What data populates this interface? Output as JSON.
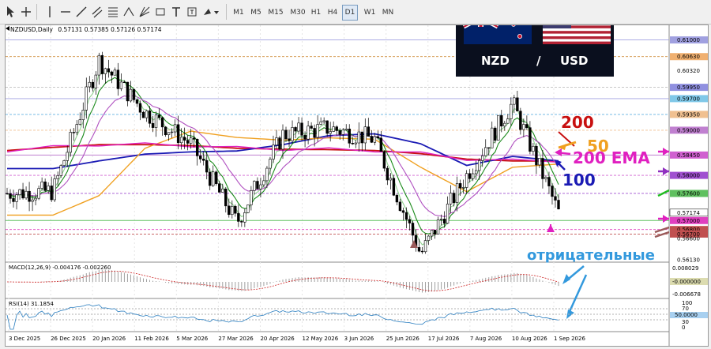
{
  "toolbar": {
    "timeframes": [
      "M1",
      "M5",
      "M15",
      "M30",
      "H1",
      "H4",
      "D1",
      "W1",
      "MN"
    ],
    "active_timeframe": "D1"
  },
  "chart_header": {
    "symbol_text": "NZDUSD,Daily",
    "ohlc_text": "0.57131 0.57385 0.57126 0.57174"
  },
  "flag_panel": {
    "base": "NZD",
    "separator": "/",
    "quote": "USD"
  },
  "annotations": {
    "ema200": "200",
    "ema50": "50",
    "ema_label": "200 EMA",
    "ema100": "100",
    "negative": "отрицательные"
  },
  "price_axis": {
    "labels": [
      "0.61000",
      "0.60630",
      "0.60320",
      "0.59950",
      "0.59700",
      "0.59350",
      "0.59000",
      "0.58450",
      "0.58000",
      "0.57600",
      "0.57174",
      "0.57000",
      "0.56800",
      "0.56700",
      "0.56600",
      "0.56130"
    ]
  },
  "macd": {
    "label": "MACD(12,26,9) -0.004176 -0.002260",
    "axis": [
      "0.008029",
      "-0.000000",
      "-0.006678"
    ]
  },
  "rsi": {
    "label": "RSI(14) 31.1854",
    "axis": [
      "100",
      "70",
      "50.0000",
      "30",
      "0"
    ]
  },
  "time_axis": {
    "labels": [
      "3 Dec 2025",
      "26 Dec 2025",
      "20 Jan 2026",
      "11 Feb 2026",
      "5 Mar 2026",
      "27 Mar 2026",
      "20 Apr 2026",
      "12 May 2026",
      "3 Jun 2026",
      "25 Jun 2026",
      "17 Jul 2026",
      "7 Aug 2026",
      "10 Aug 2026",
      "1 Sep 2026"
    ]
  },
  "colors": {
    "ema200": "#c81010",
    "ema100": "#1a1ab4",
    "ema50": "#f0a020",
    "ema_pink": "#e020c0",
    "fast_ma": "#1a8a1a",
    "slow_ma": "#b050c0",
    "annotation_blue": "#3399dd"
  },
  "chart_data": {
    "type": "line",
    "title": "NZDUSD,Daily",
    "instrument": "NZD/USD",
    "timeframe": "D1",
    "x": [
      "3 Dec 2025",
      "26 Dec 2025",
      "20 Jan 2026",
      "11 Feb 2026",
      "5 Mar 2026",
      "27 Mar 2026",
      "20 Apr 2026",
      "12 May 2026",
      "3 Jun 2026",
      "25 Jun 2026",
      "17 Jul 2026",
      "7 Aug 2026",
      "1 Sep 2026"
    ],
    "ylim": [
      0.5613,
      0.6115
    ],
    "price_close": [
      0.576,
      0.5765,
      0.6055,
      0.594,
      0.587,
      0.5695,
      0.589,
      0.5905,
      0.588,
      0.5625,
      0.58,
      0.596,
      0.5717
    ],
    "last_ohlc": {
      "open": 0.57131,
      "high": 0.57385,
      "low": 0.57126,
      "close": 0.57174
    },
    "series": [
      {
        "name": "200",
        "values": [
          0.5855,
          0.5862,
          0.5868,
          0.5868,
          0.5866,
          0.586,
          0.5858,
          0.5857,
          0.5855,
          0.5848,
          0.5836,
          0.5832,
          0.5832
        ]
      },
      {
        "name": "100",
        "values": [
          0.5815,
          0.5815,
          0.5832,
          0.5847,
          0.5852,
          0.5854,
          0.5868,
          0.5888,
          0.5892,
          0.587,
          0.5822,
          0.5842,
          0.5832
        ]
      },
      {
        "name": "50",
        "values": [
          0.5712,
          0.5712,
          0.5755,
          0.586,
          0.5898,
          0.5884,
          0.5878,
          0.5883,
          0.588,
          0.5818,
          0.5764,
          0.5818,
          0.5825
        ]
      }
    ],
    "horizontal_levels": [
      0.61,
      0.6063,
      0.5995,
      0.597,
      0.5935,
      0.59,
      0.5845,
      0.58,
      0.576,
      0.57,
      0.568,
      0.567
    ]
  }
}
